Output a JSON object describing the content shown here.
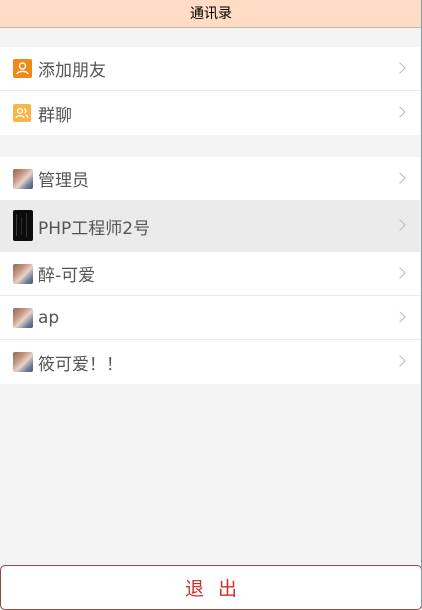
{
  "header": {
    "title": "通讯录"
  },
  "actions": [
    {
      "label": "添加朋友",
      "icon": "add-friend-icon"
    },
    {
      "label": "群聊",
      "icon": "group-chat-icon"
    }
  ],
  "contacts": [
    {
      "name": "管理员",
      "icon": "avatar"
    },
    {
      "name": "PHP工程师2号",
      "icon": "avatar"
    },
    {
      "name": "醉-可爱",
      "icon": "avatar"
    },
    {
      "name": "ap",
      "icon": "avatar"
    },
    {
      "name": "筱可爱！！",
      "icon": "avatar"
    }
  ],
  "logout": {
    "label": "退出"
  },
  "colors": {
    "header_bg": "#ffdcc3",
    "logout_text": "#d62d2d",
    "add_icon": "#f08a16",
    "group_icon": "#f7b54a"
  }
}
